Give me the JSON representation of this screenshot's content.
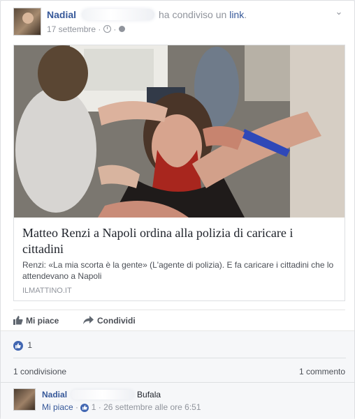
{
  "post": {
    "author": "Nadia",
    "author_suffix": "l",
    "action_text": "ha condiviso un",
    "action_link": "link",
    "action_end": ".",
    "date": "17 settembre",
    "privacy_icon": "globe-icon"
  },
  "link_preview": {
    "title": "Matteo Renzi a Napoli ordina alla polizia di caricare i cittadini",
    "description": "Renzi: «La mia scorta è la gente» (L'agente di polizia). E fa caricare i cittadini che lo attendevano a Napoli",
    "source": "ILMATTINO.IT"
  },
  "actions": {
    "like": "Mi piace",
    "share": "Condividi"
  },
  "reactions": {
    "like_count": "1",
    "shares": "1 condivisione",
    "comments": "1 commento"
  },
  "comment": {
    "author": "Nadia",
    "author_suffix": "l",
    "text": "Bufala",
    "like_label": "Mi piace",
    "sep1": "·",
    "like_count": "1",
    "sep2": "·",
    "time": "26 settembre alle ore 6:51"
  },
  "colors": {
    "link_blue": "#365899",
    "like_blue": "#4267b2",
    "muted_gray": "#90949c"
  }
}
